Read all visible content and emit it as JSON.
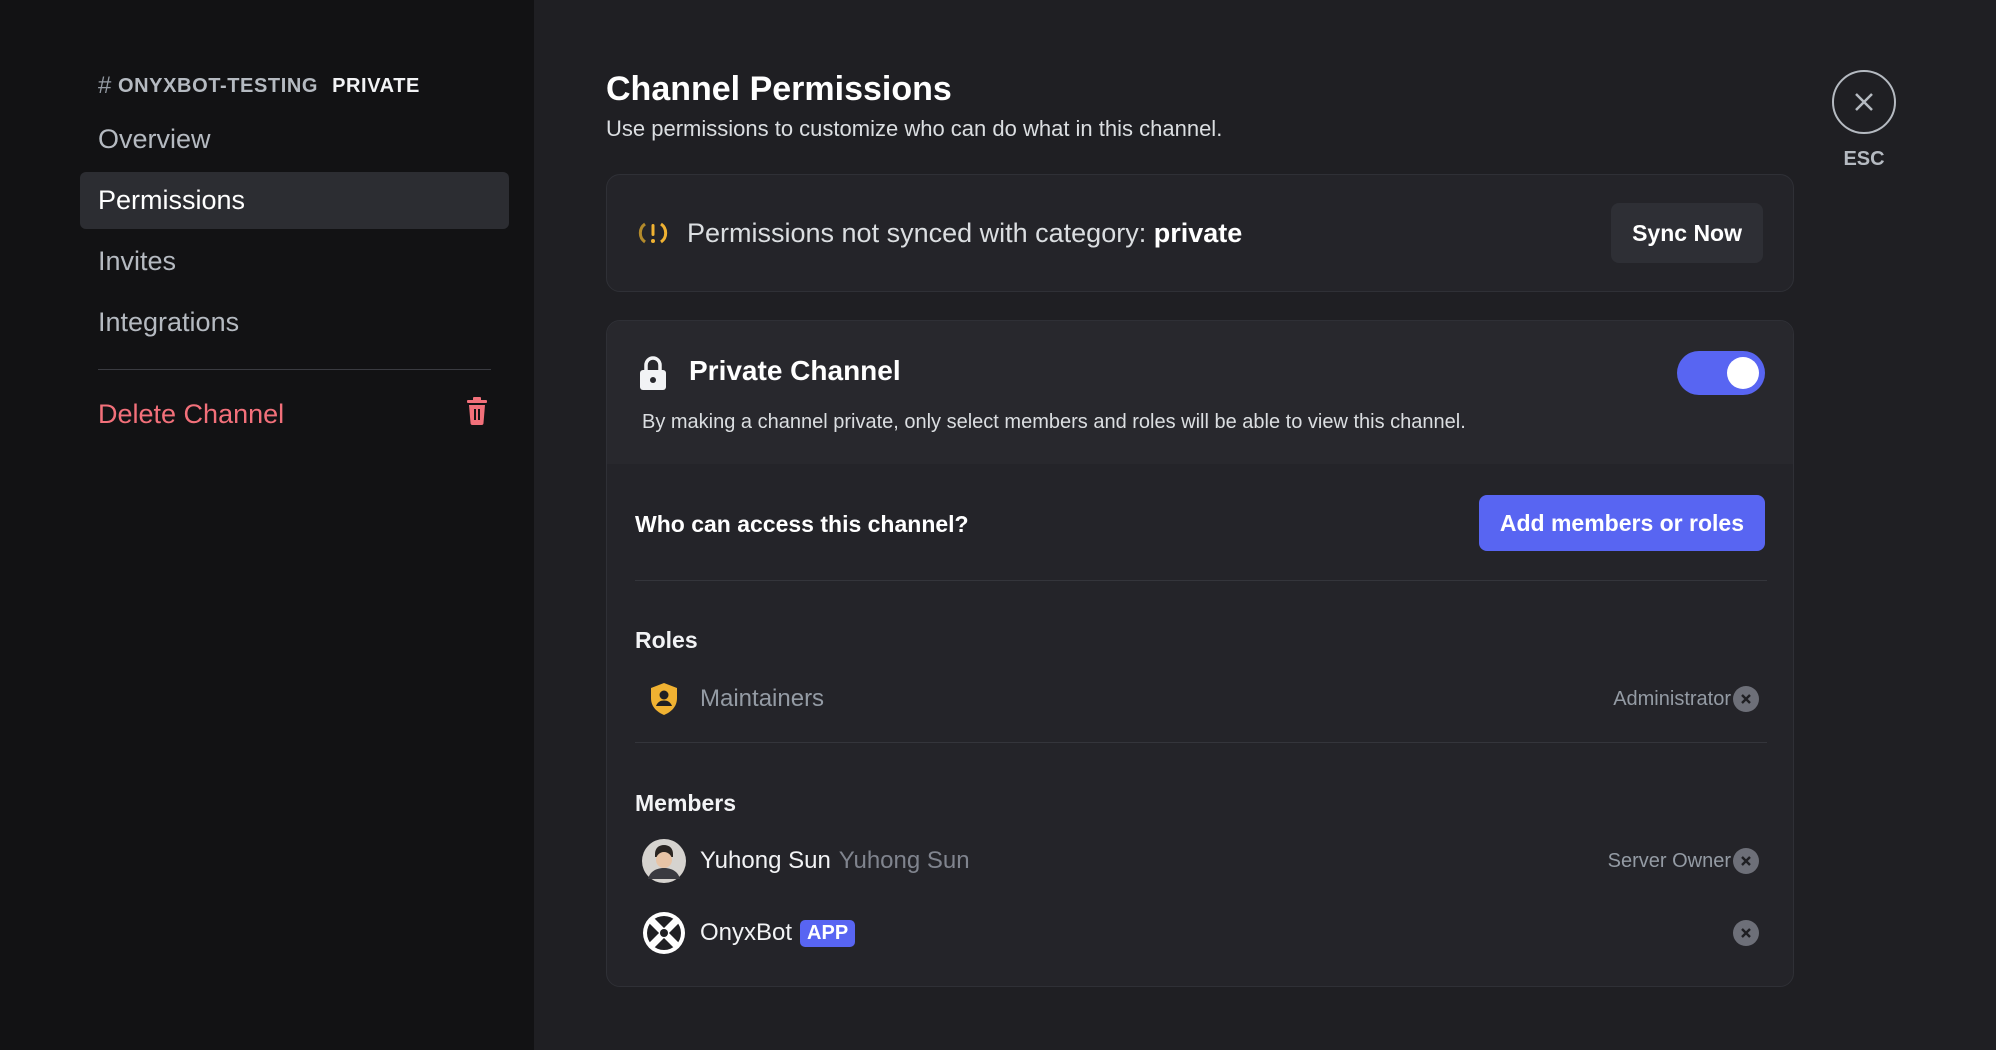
{
  "sidebar": {
    "channel_hash": "#",
    "channel_name": "ONYXBOT-TESTING",
    "category": "PRIVATE",
    "items": [
      {
        "label": "Overview",
        "active": false
      },
      {
        "label": "Permissions",
        "active": true
      },
      {
        "label": "Invites",
        "active": false
      },
      {
        "label": "Integrations",
        "active": false
      }
    ],
    "delete_label": "Delete Channel"
  },
  "main": {
    "title": "Channel Permissions",
    "subtitle": "Use permissions to customize who can do what in this channel.",
    "sync": {
      "text": "Permissions not synced with category:",
      "category": "private",
      "button": "Sync Now"
    },
    "private_channel": {
      "title": "Private Channel",
      "enabled": true,
      "description": "By making a channel private, only select members and roles will be able to view this channel.",
      "access_question": "Who can access this channel?",
      "add_button": "Add members or roles",
      "roles_label": "Roles",
      "roles": [
        {
          "name": "Maintainers",
          "right_label": "Administrator",
          "icon": "shield-user-icon"
        }
      ],
      "members_label": "Members",
      "members": [
        {
          "name": "Yuhong Sun",
          "secondary": "Yuhong Sun",
          "right_label": "Server Owner",
          "icon": "avatar"
        },
        {
          "name": "OnyxBot",
          "tag": "APP",
          "right_label": "",
          "icon": "onyx-logo-icon"
        }
      ]
    }
  },
  "close": {
    "label": "ESC"
  },
  "colors": {
    "accent": "#5865f2",
    "danger": "#f2707a",
    "warning": "#f0b232"
  }
}
